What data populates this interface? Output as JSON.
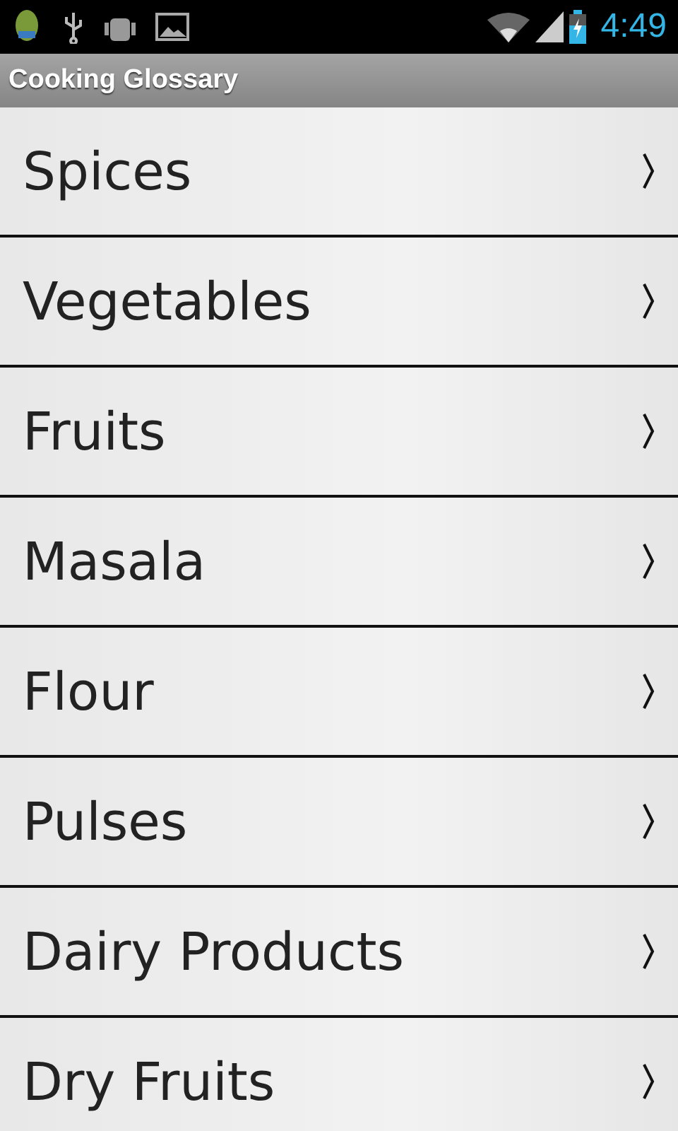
{
  "status_bar": {
    "time": "4:49"
  },
  "title_bar": {
    "title": "Cooking Glossary"
  },
  "list": [
    {
      "label": "Spices"
    },
    {
      "label": "Vegetables"
    },
    {
      "label": "Fruits"
    },
    {
      "label": "Masala"
    },
    {
      "label": "Flour"
    },
    {
      "label": "Pulses"
    },
    {
      "label": "Dairy Products"
    },
    {
      "label": "Dry Fruits"
    }
  ]
}
